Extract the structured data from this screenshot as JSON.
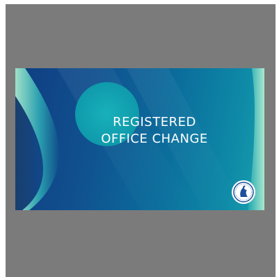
{
  "banner": {
    "title_line1": "REGISTERED",
    "title_line2": "OFFICE CHANGE"
  },
  "colors": {
    "viewer_background": "#7b7b7b",
    "banner_dark_blue": "#0f3d82",
    "banner_teal": "#1aa1ad",
    "circle_teal": "#12a3b2",
    "accent_mint": "#8fdac6",
    "text": "#ffffff"
  },
  "icons": {
    "logo": "emblem-logo-icon"
  }
}
